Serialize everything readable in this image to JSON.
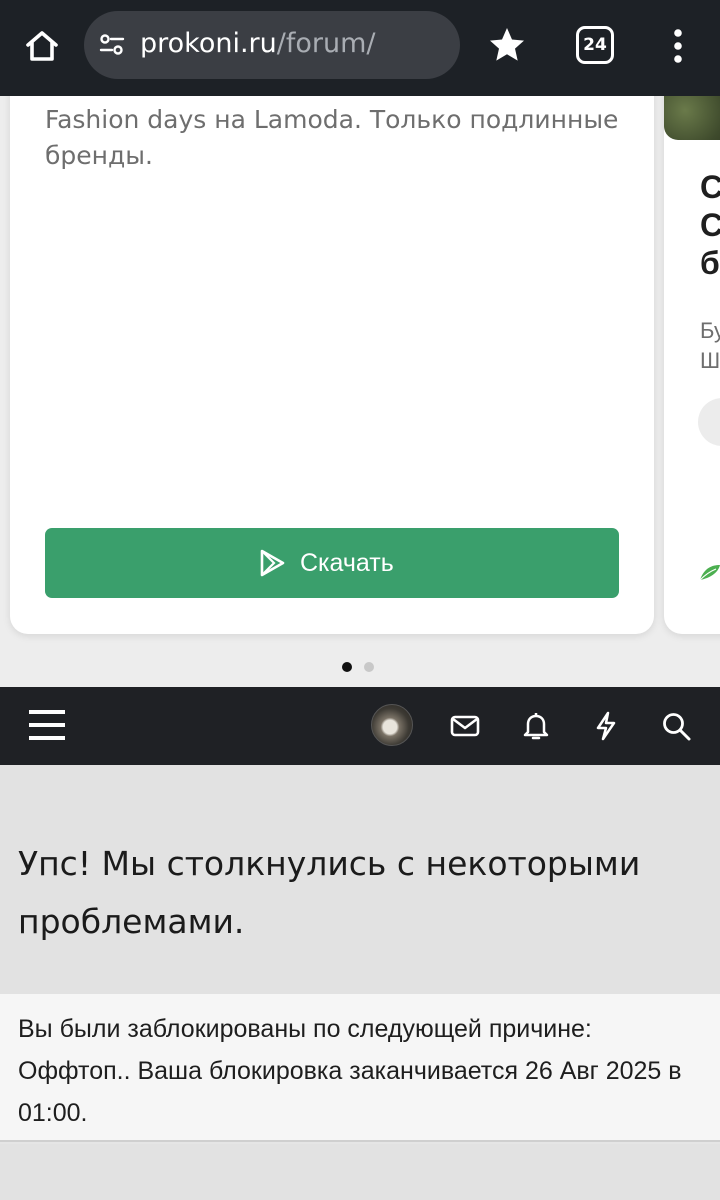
{
  "browser": {
    "url_host": "prokoni.ru",
    "url_path": "/forum/",
    "tab_count": "24",
    "icons": {
      "home": "home-icon",
      "site_settings": "tune-icon",
      "bookmark": "star-icon",
      "menu": "more-vert-icon"
    }
  },
  "ad": {
    "description": "Fashion days на Lamoda. Только подлинные бренды.",
    "button_label": "Скачать",
    "button_color": "#3a9f6c",
    "next_card": {
      "title_fragment": "С С б",
      "text_fragment": "Бу Ш"
    },
    "carousel": {
      "pages": 2,
      "active": 1
    }
  },
  "forum_nav": {
    "icons": [
      "menu-icon",
      "avatar",
      "mail-icon",
      "bell-icon",
      "bolt-icon",
      "search-icon"
    ]
  },
  "error": {
    "title": "Упс! Мы столкнулись с некоторыми проблемами.",
    "message": "Вы были заблокированы по следующей причине: Оффтоп.. Ваша блокировка заканчивается 26 Авг 2025 в 01:00."
  }
}
